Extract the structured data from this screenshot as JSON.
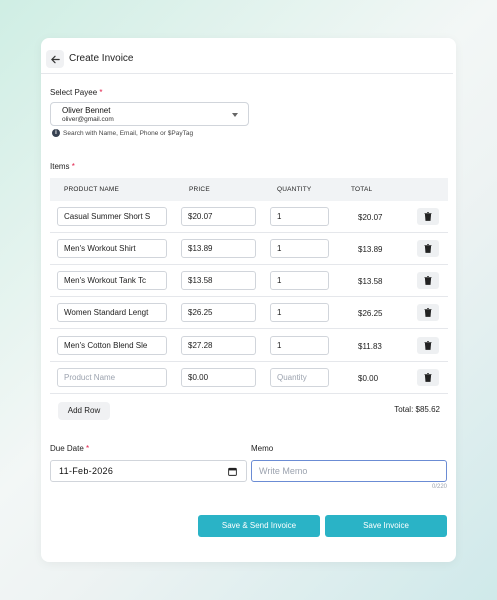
{
  "header": {
    "title": "Create Invoice"
  },
  "payee": {
    "label": "Select Payee",
    "required_mark": "*",
    "name": "Oliver Bennet",
    "email": "oliver@gmail.com",
    "hint": "Search with Name, Email, Phone or $PayTag"
  },
  "items": {
    "label": "Items",
    "required_mark": "*",
    "columns": [
      "PRODUCT NAME",
      "PRICE",
      "QUANTITY",
      "TOTAL"
    ],
    "rows": [
      {
        "product": "Casual Summer Short S",
        "price": "$20.07",
        "quantity": "1",
        "total": "$20.07"
      },
      {
        "product": "Men's Workout Shirt",
        "price": "$13.89",
        "quantity": "1",
        "total": "$13.89"
      },
      {
        "product": "Men's Workout Tank Tc",
        "price": "$13.58",
        "quantity": "1",
        "total": "$13.58"
      },
      {
        "product": "Women Standard Lengt",
        "price": "$26.25",
        "quantity": "1",
        "total": "$26.25"
      },
      {
        "product": "Men's Cotton Blend Sle",
        "price": "$27.28",
        "quantity": "1",
        "total": "$11.83"
      }
    ],
    "new_row": {
      "product_placeholder": "Product Name",
      "price": "$0.00",
      "quantity_placeholder": "Quantity",
      "total": "$0.00"
    },
    "add_row_label": "Add Row",
    "grand_total": "Total: $85.62"
  },
  "due_date": {
    "label": "Due Date",
    "required_mark": "*",
    "value": "11-Feb-2026"
  },
  "memo": {
    "label": "Memo",
    "placeholder": "Write Memo",
    "counter": "0/220"
  },
  "actions": {
    "save_send_label": "Save & Send Invoice",
    "save_label": "Save Invoice"
  },
  "colors": {
    "accent": "#2ab3c6",
    "required": "#e11d48",
    "focus_border": "#6b8cd4"
  }
}
